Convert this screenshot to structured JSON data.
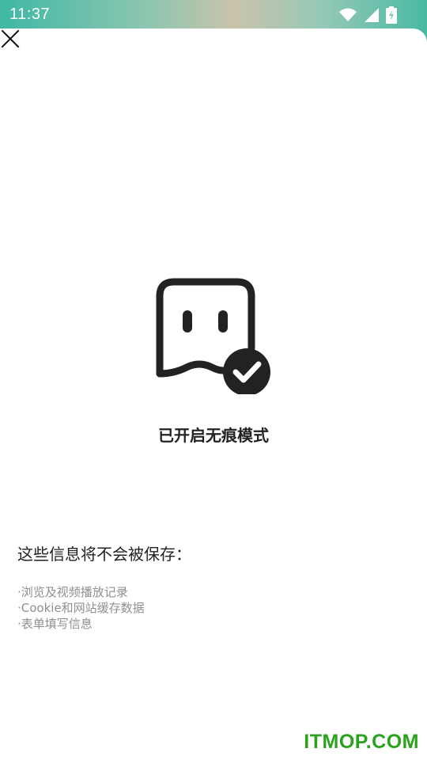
{
  "status_bar": {
    "time": "11:37",
    "icons": [
      "wifi-icon",
      "cell-signal-icon",
      "battery-charging-icon"
    ]
  },
  "close_button": {
    "icon": "close-icon"
  },
  "hero": {
    "icon": "incognito-ghost-check-icon",
    "title": "已开启无痕模式"
  },
  "info": {
    "heading": "这些信息将不会被保存：",
    "items": [
      "·浏览及视频播放记录",
      "·Cookie和网站缓存数据",
      "·表单填写信息"
    ]
  },
  "watermark": {
    "text": "ITMOP.COM",
    "color": "#2aa21d"
  },
  "colors": {
    "accent_dark": "#222222",
    "muted_text": "#8f8f8f"
  }
}
